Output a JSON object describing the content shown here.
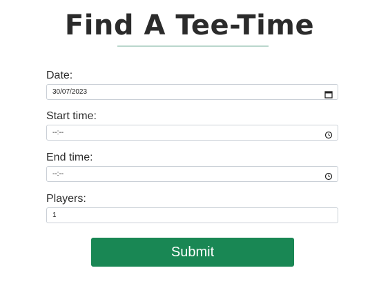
{
  "page": {
    "title": "Find A Tee-Time"
  },
  "form": {
    "date": {
      "label": "Date:",
      "value": "30/07/2023",
      "icon": "calendar-icon"
    },
    "start_time": {
      "label": "Start time:",
      "value": "--:--",
      "icon": "clock-icon"
    },
    "end_time": {
      "label": "End time:",
      "value": "--:--",
      "icon": "clock-icon"
    },
    "players": {
      "label": "Players:",
      "value": "1"
    },
    "submit_label": "Submit"
  },
  "colors": {
    "submit_background": "#198754",
    "title_underline": "#b9d6cc"
  }
}
